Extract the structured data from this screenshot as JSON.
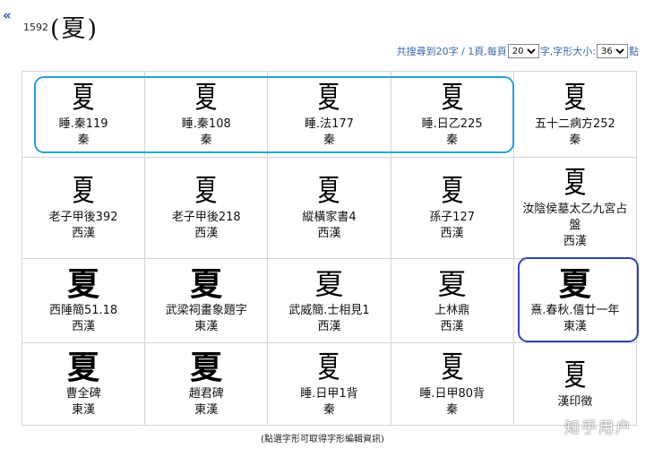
{
  "header": {
    "back_label": "«",
    "char_id": "1592",
    "title": "(夏)"
  },
  "toolbar": {
    "summary_text": "共搜尋到20字 / 1頁,",
    "per_page_label": "每頁",
    "per_page_value": "20",
    "per_page_unit": "字,",
    "font_size_label": "字形大小:",
    "font_size_value": "36",
    "font_size_unit": "點"
  },
  "grid": [
    [
      {
        "glyph": "夏",
        "source": "睡.秦119",
        "era": "秦"
      },
      {
        "glyph": "夏",
        "source": "睡.秦108",
        "era": "秦"
      },
      {
        "glyph": "夏",
        "source": "睡.法177",
        "era": "秦"
      },
      {
        "glyph": "夏",
        "source": "睡.日乙225",
        "era": "秦"
      },
      {
        "glyph": "夏",
        "source": "五十二病方252",
        "era": "秦"
      }
    ],
    [
      {
        "glyph": "夏",
        "source": "老子甲後392",
        "era": "西漢"
      },
      {
        "glyph": "夏",
        "source": "老子甲後218",
        "era": "西漢"
      },
      {
        "glyph": "夏",
        "source": "縱橫家書4",
        "era": "西漢"
      },
      {
        "glyph": "夏",
        "source": "孫子127",
        "era": "西漢"
      },
      {
        "glyph": "夏",
        "source": "汝陰侯墓太乙九宮占盤",
        "era": "西漢"
      }
    ],
    [
      {
        "glyph": "夏",
        "source": "西陲簡51.18",
        "era": "西漢"
      },
      {
        "glyph": "夏",
        "source": "武梁祠畫象題字",
        "era": "東漢"
      },
      {
        "glyph": "夏",
        "source": "武威簡.士相見1",
        "era": "西漢"
      },
      {
        "glyph": "夏",
        "source": "上林鼎",
        "era": "西漢"
      },
      {
        "glyph": "夏",
        "source": "熹.春秋.僖廿一年",
        "era": "東漢"
      }
    ],
    [
      {
        "glyph": "夏",
        "source": "曹全碑",
        "era": "東漢"
      },
      {
        "glyph": "夏",
        "source": "趙君碑",
        "era": "東漢"
      },
      {
        "glyph": "夏",
        "source": "睡.日甲1背",
        "era": "秦"
      },
      {
        "glyph": "夏",
        "source": "睡.日甲80背",
        "era": "秦"
      },
      {
        "glyph": "夏",
        "source": "漢印徵",
        "era": ""
      }
    ]
  ],
  "footer": "(點選字形可取得字形編輯資訊)",
  "watermark": "知乎用户",
  "colors": {
    "link_blue": "#3d67a6",
    "highlight_row": "#2aa0d6",
    "highlight_cell": "#3144a8"
  }
}
